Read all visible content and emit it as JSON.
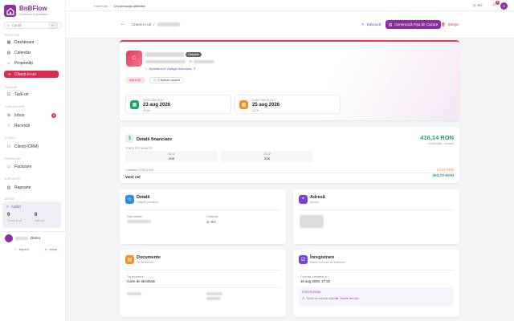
{
  "brand": {
    "name": "BnBFlow",
    "subtitle": "Gestionati proprietatea"
  },
  "search": {
    "placeholder": "Caută",
    "shortcut": "⌘K"
  },
  "sections": {
    "main": "PRINCIPAL",
    "taskuri": "TASKURI",
    "comunicare": "COMUNICARE",
    "clienti": "CLIENȚI",
    "financiar": "FINANCIAR",
    "rapoarte": "RAPOARTE",
    "astazi": "ASTĂZI"
  },
  "nav": {
    "dashboard": "Dashboard",
    "calendar": "Calendar",
    "proprietati": "Proprietăți",
    "checkin": "Check-in-uri",
    "taskuri": "Task-uri",
    "inbox": "Inbox",
    "inbox_count": "4",
    "recenzii": "Recenzii",
    "clienti": "Clienți (CRM)",
    "facturare": "Facturare",
    "rapoarte": "Rapoarte"
  },
  "activity": {
    "title": "Astăzi",
    "checkin_count": "0",
    "checkin_label": "Check-in-uri",
    "checkout_count": "0",
    "checkout_label": "Ieșiri azi"
  },
  "profile": {
    "name": "Demo",
    "theme": "Aspect",
    "logout": "Ieșire"
  },
  "topbar": {
    "crumb1": "Rezervări",
    "crumb2": "Cht-demougi-u5dt4fav",
    "lang": "RO",
    "notif_count": "3",
    "avatar": "A"
  },
  "header": {
    "back": "Check-in-uri",
    "sep": "/",
    "edit": "Editează",
    "generate": "Generează Fișa de Cazare",
    "delete": "Șterge"
  },
  "guest": {
    "avatar": "C",
    "tag": "Oaspete",
    "property": "Apartament Vintage Aninoasa",
    "property_arrow": "↗",
    "status": "ANULAT",
    "guests": "2 Număr oaspeți",
    "checkin_label": "DATA CHECK-IN",
    "checkin_date": "23 aug 2026",
    "checkin_time": "15:00",
    "checkout_label": "DATA CHECK-OUT",
    "checkout_date": "25 aug 2026",
    "checkout_time": "11:00"
  },
  "finance": {
    "title": "Detalii financiare",
    "total": "416,14 RON",
    "total_sub": "Sumă totală - încasată",
    "breakdown_label": "TOATE PER NOAPTE",
    "night1_date": "23.12",
    "night1_price": "208",
    "night2_date": "24.12",
    "night2_price": "208",
    "commission_label": "Comision OTA (15%)",
    "commission_value": "-62,42 RON",
    "net_label": "Venit net",
    "net_value": "353,72 RON"
  },
  "details": {
    "title": "Detalii",
    "sub": "Oaspeți principali",
    "label1": "Data nașterii",
    "label2": "Cetățenie",
    "nationality": "RO"
  },
  "address": {
    "title": "Adresă",
    "sub": "Adresă"
  },
  "documents": {
    "title": "Documente",
    "sub": "Tip document",
    "doc_type_label": "Tip document",
    "doc_type_value": "Carte de Identitate",
    "label2": "Număr",
    "label3": "Emitent"
  },
  "registration": {
    "title": "Înregistrare",
    "sub": "Status formular de înditinare",
    "completed_label": "Formular completat la",
    "completed_value": "16 aug 2026, 17:32",
    "email_status_label": "STATUS EMAIL",
    "email_status_value": "Trimis pe adresă oaspete",
    "resend": "Trimite din nou"
  },
  "colors": {
    "accent": "#d92a4f",
    "brand": "#8b2ea0",
    "purple": "#7a3fd6",
    "green": "#1aa36b",
    "orange": "#f2902b",
    "blue": "#2e8fd6"
  }
}
